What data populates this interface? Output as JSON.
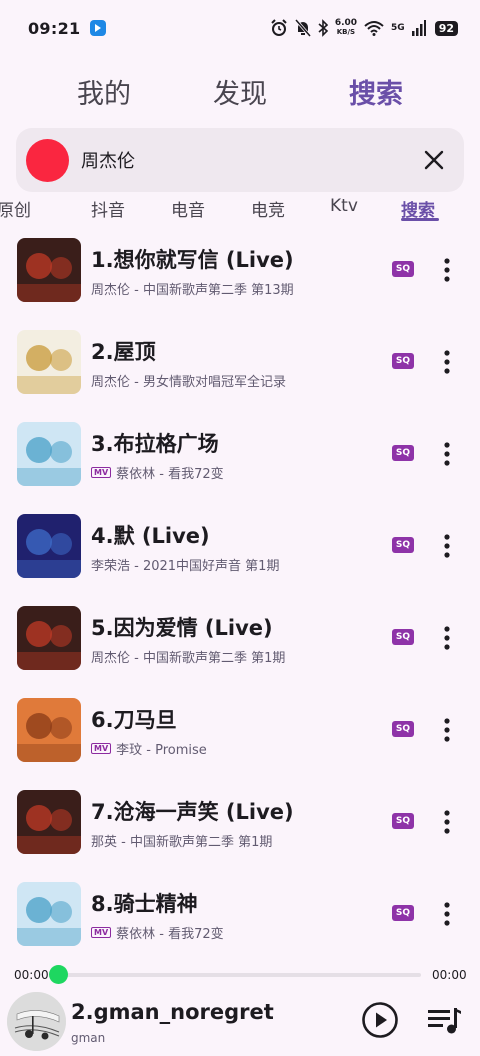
{
  "status": {
    "time": "09:21",
    "net_speed_value": "6.00",
    "net_speed_unit": "KB/S",
    "net_type": "5G",
    "battery": "92"
  },
  "tabs": [
    "我的",
    "发现",
    "搜索"
  ],
  "search": {
    "query": "周杰伦"
  },
  "sub_tabs": [
    "原创",
    "抖音",
    "电音",
    "电竞",
    "Ktv",
    "搜索"
  ],
  "songs": [
    {
      "title": "1.想你就写信 (Live)",
      "subtitle": "周杰伦 - 中国新歌声第二季 第13期",
      "mv": false,
      "badge": "SQ",
      "cover_colors": [
        "#3a1e1a",
        "#c03a26"
      ]
    },
    {
      "title": "2.屋顶",
      "subtitle": "周杰伦 - 男女情歌对唱冠军全记录",
      "mv": false,
      "badge": "SQ",
      "cover_colors": [
        "#f3eee1",
        "#c89a38"
      ]
    },
    {
      "title": "3.布拉格广场",
      "subtitle": "蔡依林 - 看我72变",
      "mv": true,
      "mv_label": "MV",
      "badge": "SQ",
      "cover_colors": [
        "#cfe6f4",
        "#4aa0c8"
      ]
    },
    {
      "title": "4.默 (Live)",
      "subtitle": "李荣浩 - 2021中国好声音 第1期",
      "mv": false,
      "badge": "SQ",
      "cover_colors": [
        "#20216e",
        "#3e6cc9"
      ]
    },
    {
      "title": "5.因为爱情 (Live)",
      "subtitle": "周杰伦 - 中国新歌声第二季 第1期",
      "mv": false,
      "badge": "SQ",
      "cover_colors": [
        "#3a1e1a",
        "#c03a26"
      ]
    },
    {
      "title": "6.刀马旦",
      "subtitle": "李玟 - Promise",
      "mv": true,
      "mv_label": "MV",
      "badge": "SQ",
      "cover_colors": [
        "#e07a3a",
        "#8a3b17"
      ]
    },
    {
      "title": "7.沧海一声笑 (Live)",
      "subtitle": "那英 - 中国新歌声第二季 第1期",
      "mv": false,
      "badge": "SQ",
      "cover_colors": [
        "#3a1e1a",
        "#c03a26"
      ]
    },
    {
      "title": "8.骑士精神",
      "subtitle": "蔡依林 - 看我72变",
      "mv": true,
      "mv_label": "MV",
      "badge": "SQ",
      "cover_colors": [
        "#cfe6f4",
        "#4aa0c8"
      ]
    }
  ],
  "player": {
    "time_current": "00:00",
    "time_total": "00:00",
    "progress": 0,
    "title": "2.gman_noregret",
    "artist": "gman"
  },
  "colors": {
    "accent": "#6a4fa8",
    "sq_badge": "#8e33a8",
    "progress_thumb": "#1ed760",
    "search_dot": "#fa2640"
  }
}
